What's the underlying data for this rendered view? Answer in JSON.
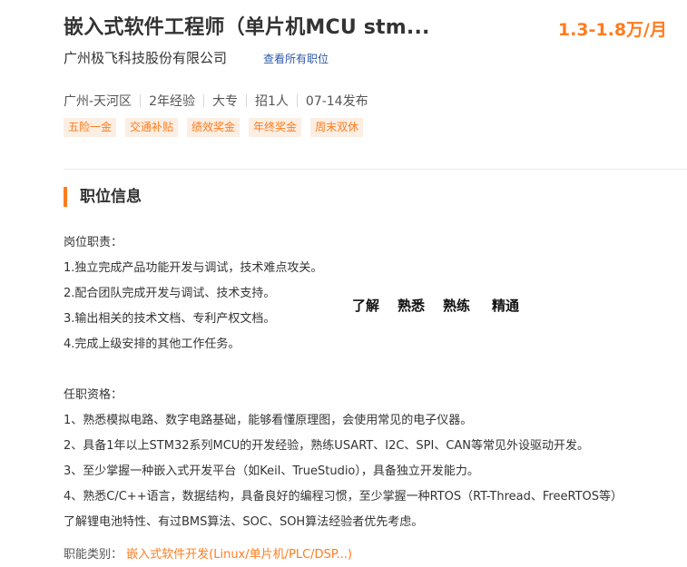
{
  "header": {
    "job_title": "嵌入式软件工程师（单片机MCU stm...",
    "salary": "1.3-1.8万/月",
    "company_name": "广州极飞科技股份有限公司",
    "all_jobs_link": "查看所有职位"
  },
  "meta": {
    "location": "广州-天河区",
    "experience": "2年经验",
    "education": "大专",
    "headcount": "招1人",
    "posted": "07-14发布"
  },
  "tags": [
    "五险一金",
    "交通补贴",
    "绩效奖金",
    "年终奖金",
    "周末双休"
  ],
  "section": {
    "title": "职位信息"
  },
  "description": {
    "duties_heading": "岗位职责：",
    "duties": [
      "1.独立完成产品功能开发与调试，技术难点攻关。",
      "2.配合团队完成开发与调试、技术支持。",
      "3.输出相关的技术文档、专利产权文档。",
      "4.完成上级安排的其他工作任务。"
    ],
    "requirements_heading": "任职资格：",
    "requirements": [
      "1、熟悉模拟电路、数字电路基础，能够看懂原理图，会使用常见的电子仪器。",
      "2、具备1年以上STM32系列MCU的开发经验，熟练USART、I2C、SPI、CAN等常见外设驱动开发。",
      "3、至少掌握一种嵌入式开发平台（如Keil、TrueStudio），具备独立开发能力。",
      "4、熟悉C/C++语言，数据结构，具备良好的编程习惯，至少掌握一种RTOS（RT-Thread、FreeRTOS等）",
      "了解锂电池特性、有过BMS算法、SOC、SOH算法经验者优先考虑。"
    ]
  },
  "skill_levels": [
    "了解",
    "熟悉",
    "熟练",
    "精通"
  ],
  "category": {
    "label": "职能类别：",
    "value": "嵌入式软件开发(Linux/单片机/PLC/DSP...)"
  },
  "colors": {
    "accent": "#ff7c1e",
    "link": "#2e58a6",
    "tag_bg": "#fbeee3"
  }
}
